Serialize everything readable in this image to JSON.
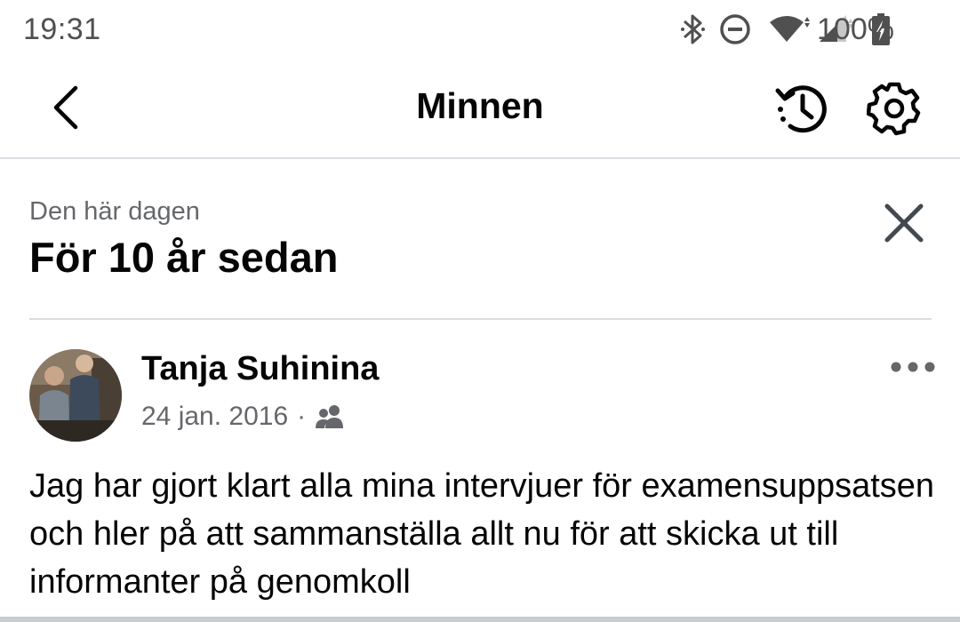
{
  "status_bar": {
    "time": "19:31",
    "battery_percent": "100%",
    "icons": [
      "bluetooth-icon",
      "do-not-disturb-icon",
      "wifi-icon",
      "cellular-signal-icon",
      "battery-charging-icon"
    ]
  },
  "header": {
    "title": "Minnen",
    "back_icon": "chevron-left-icon",
    "history_icon": "history-icon",
    "settings_icon": "gear-icon"
  },
  "memory_section": {
    "label": "Den här dagen",
    "title": "För 10 år sedan",
    "close_icon": "close-icon"
  },
  "post": {
    "author": "Tanja Suhinina",
    "date": "24 jan. 2016",
    "separator": "·",
    "audience_icon": "friends-icon",
    "more_icon": "more-horizontal-icon",
    "text": "Jag har gjort klart alla mina intervjuer för examensuppsatsen och hler på att sammanställa allt nu för att skicka ut till informanter på genomkoll"
  },
  "colors": {
    "primary_text": "#050505",
    "secondary_text": "#65676b",
    "divider": "#dadde1",
    "status_text": "#505050"
  }
}
